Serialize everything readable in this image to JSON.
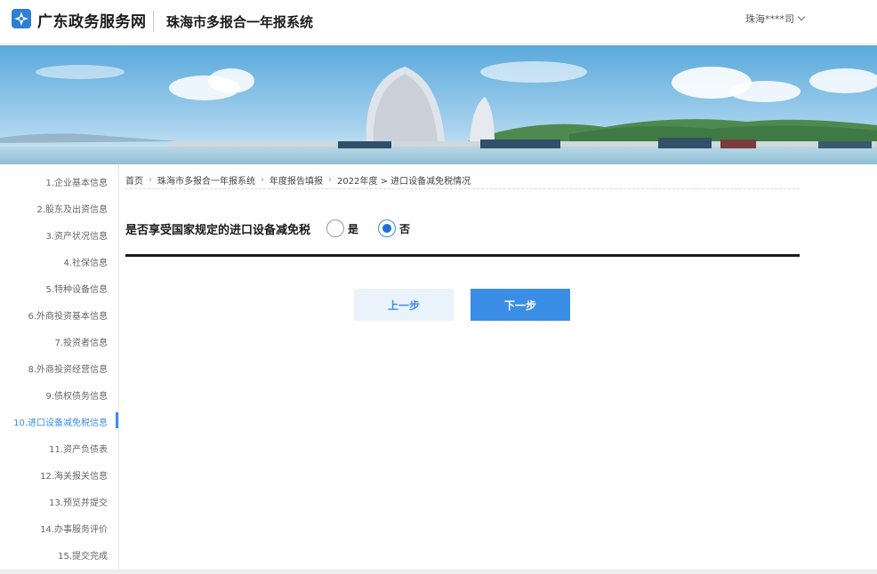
{
  "header": {
    "logo_text": "广东政务服务网",
    "system_title": "珠海市多报合一年报系统",
    "user_name": "珠海****司"
  },
  "sidebar": {
    "active_index": 9,
    "items": [
      {
        "label": "1.企业基本信息"
      },
      {
        "label": "2.股东及出资信息"
      },
      {
        "label": "3.资产状况信息"
      },
      {
        "label": "4.社保信息"
      },
      {
        "label": "5.特种设备信息"
      },
      {
        "label": "6.外商投资基本信息"
      },
      {
        "label": "7.投资者信息"
      },
      {
        "label": "8.外商投资经营信息"
      },
      {
        "label": "9.债权债务信息"
      },
      {
        "label": "10.进口设备减免税信息"
      },
      {
        "label": "11.资产负债表"
      },
      {
        "label": "12.海关报关信息"
      },
      {
        "label": "13.预览并提交"
      },
      {
        "label": "14.办事服务评价"
      },
      {
        "label": "15.提交完成"
      }
    ]
  },
  "breadcrumb": {
    "home": "首页",
    "system": "珠海市多报合一年报系统",
    "fill": "年度报告填报",
    "current": "2022年度 > 进口设备减免税情况"
  },
  "form": {
    "question": "是否享受国家规定的进口设备减免税",
    "option_yes": "是",
    "option_no": "否",
    "selected": "否"
  },
  "buttons": {
    "prev": "上一步",
    "next": "下一步"
  },
  "colors": {
    "accent": "#3a8ee6",
    "accent_light": "#eaf3fb"
  }
}
